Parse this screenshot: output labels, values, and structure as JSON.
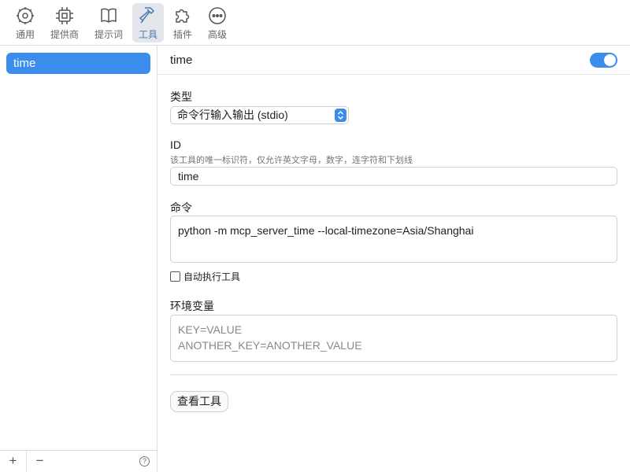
{
  "toolbar": {
    "items": [
      {
        "label": "通用",
        "icon": "gear-icon"
      },
      {
        "label": "提供商",
        "icon": "chip-icon"
      },
      {
        "label": "提示词",
        "icon": "book-icon"
      },
      {
        "label": "工具",
        "icon": "hammer-icon"
      },
      {
        "label": "插件",
        "icon": "puzzle-icon"
      },
      {
        "label": "高级",
        "icon": "more-icon"
      }
    ],
    "active_index": 3,
    "active_color": "#4a78b4"
  },
  "sidebar": {
    "items": [
      {
        "label": "time"
      }
    ],
    "selected_color": "#3b8ded",
    "footer": {
      "add": "+",
      "remove": "−",
      "help": "?"
    }
  },
  "main": {
    "title": "time",
    "enabled": true,
    "type_label": "类型",
    "type_value": "命令行输入输出 (stdio)",
    "id_label": "ID",
    "id_hint": "该工具的唯一标识符，仅允许英文字母，数字，连字符和下划线",
    "id_value": "time",
    "command_label": "命令",
    "command_value": "python -m mcp_server_time --local-timezone=Asia/Shanghai",
    "auto_exec_label": "自动执行工具",
    "auto_exec_checked": false,
    "env_label": "环境变量",
    "env_placeholder": "KEY=VALUE\nANOTHER_KEY=ANOTHER_VALUE",
    "view_tools_button": "查看工具"
  }
}
